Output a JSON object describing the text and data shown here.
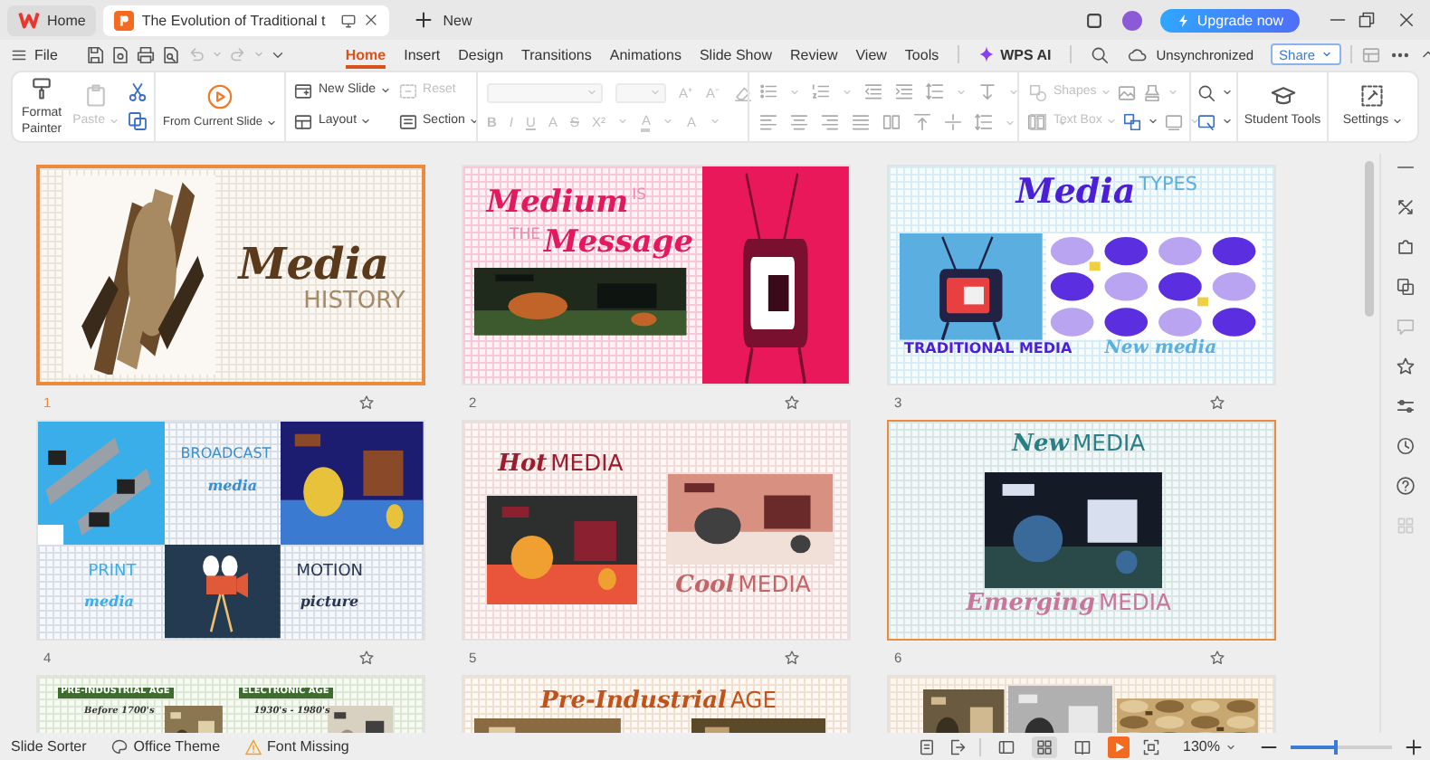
{
  "title_bar": {
    "tabs": [
      {
        "label": "Home",
        "kind": "home",
        "selected": false
      },
      {
        "label": "The Evolution of Traditional t",
        "kind": "document",
        "selected": true
      }
    ],
    "new_tab": "New",
    "upgrade": "Upgrade now"
  },
  "menu_bar": {
    "file": "File",
    "tabs": [
      {
        "label": "Home",
        "selected": true
      },
      {
        "label": "Insert",
        "selected": false
      },
      {
        "label": "Design",
        "selected": false
      },
      {
        "label": "Transitions",
        "selected": false
      },
      {
        "label": "Animations",
        "selected": false
      },
      {
        "label": "Slide Show",
        "selected": false
      },
      {
        "label": "Review",
        "selected": false
      },
      {
        "label": "View",
        "selected": false
      },
      {
        "label": "Tools",
        "selected": false
      },
      {
        "label": "WPS AI",
        "selected": false,
        "kind": "ai"
      }
    ],
    "sync_status": "Unsynchronized",
    "share": "Share"
  },
  "ribbon": {
    "format_painter": "Format Painter",
    "paste": {
      "label": "Paste",
      "disabled": true
    },
    "from_current_slide": "From Current Slide",
    "new_slide": "New Slide",
    "reset": {
      "label": "Reset",
      "disabled": true
    },
    "layout": "Layout",
    "section": "Section",
    "font_buttons": {
      "disabled": true,
      "grow_shrink": [
        "A⁺",
        "A⁻"
      ],
      "styles": [
        "B",
        "I",
        "U",
        "A",
        "S",
        "X²",
        "A",
        "A"
      ]
    },
    "shapes": {
      "label": "Shapes",
      "disabled": true
    },
    "text_box": {
      "label": "Text Box",
      "disabled": true
    },
    "student_tools": "Student Tools",
    "settings": "Settings"
  },
  "slides": [
    {
      "number": "1",
      "kind": "history",
      "selected": true,
      "current": true,
      "lines": [
        [
          {
            "text": "Media",
            "script": true
          }
        ],
        [
          {
            "text": "HISTORY",
            "script": false
          }
        ]
      ]
    },
    {
      "number": "2",
      "kind": "medium",
      "selected": false,
      "current": false,
      "lines": [
        [
          {
            "text": "Medium",
            "script": true
          },
          {
            "text": "IS",
            "script": false
          }
        ],
        [
          {
            "text": "THE",
            "script": false
          },
          {
            "text": "Message",
            "script": true
          }
        ]
      ]
    },
    {
      "number": "3",
      "kind": "types",
      "selected": false,
      "current": false,
      "lines": [
        [
          {
            "text": "Media",
            "script": true
          },
          {
            "text": "TYPES",
            "script": false
          }
        ],
        [
          {
            "text": "TRADITIONAL MEDIA",
            "script": false
          }
        ],
        [
          {
            "text": "New media",
            "script": true
          }
        ]
      ]
    },
    {
      "number": "4",
      "kind": "four",
      "selected": false,
      "current": false,
      "lines": [
        [
          {
            "text": "BROADCAST",
            "script": false
          }
        ],
        [
          {
            "text": "media",
            "script": true
          }
        ],
        [
          {
            "text": "PRINT",
            "script": false
          }
        ],
        [
          {
            "text": "media",
            "script": true
          }
        ],
        [
          {
            "text": "MOTION",
            "script": false
          }
        ],
        [
          {
            "text": "picture",
            "script": true
          }
        ]
      ]
    },
    {
      "number": "5",
      "kind": "hotcool",
      "selected": false,
      "current": false,
      "lines": [
        [
          {
            "text": "Hot",
            "script": true
          },
          {
            "text": "MEDIA",
            "script": false
          }
        ],
        [
          {
            "text": "Cool",
            "script": true
          },
          {
            "text": "MEDIA",
            "script": false
          }
        ]
      ]
    },
    {
      "number": "6",
      "kind": "newmedia",
      "selected": true,
      "current": false,
      "lines": [
        [
          {
            "text": "New",
            "script": true
          },
          {
            "text": "MEDIA",
            "script": false
          }
        ],
        [
          {
            "text": "Emerging",
            "script": true
          },
          {
            "text": "MEDIA",
            "script": false
          }
        ]
      ]
    },
    {
      "kind": "ages",
      "selected": false,
      "current": false,
      "lines": [
        [
          {
            "text": "PRE-INDUSTRIAL AGE",
            "script": false
          }
        ],
        [
          {
            "text": "Before 1700's",
            "script": true
          }
        ],
        [
          {
            "text": "ELECTRONIC AGE",
            "script": false
          }
        ],
        [
          {
            "text": "1930's - 1980's",
            "script": true
          }
        ]
      ]
    },
    {
      "kind": "preindustrial",
      "selected": false,
      "current": false,
      "lines": [
        [
          {
            "text": "Pre-Industrial",
            "script": true
          },
          {
            "text": "AGE",
            "script": false
          }
        ]
      ]
    },
    {
      "kind": "photos",
      "selected": false,
      "current": false
    }
  ],
  "status_bar": {
    "view_name": "Slide Sorter",
    "theme": "Office Theme",
    "font_warning": "Font Missing",
    "views": [
      {
        "kind": "normal",
        "selected": false
      },
      {
        "kind": "sorter",
        "selected": true
      },
      {
        "kind": "reading",
        "selected": false
      }
    ],
    "zoom": {
      "value": "130%",
      "level": 0.45
    }
  }
}
